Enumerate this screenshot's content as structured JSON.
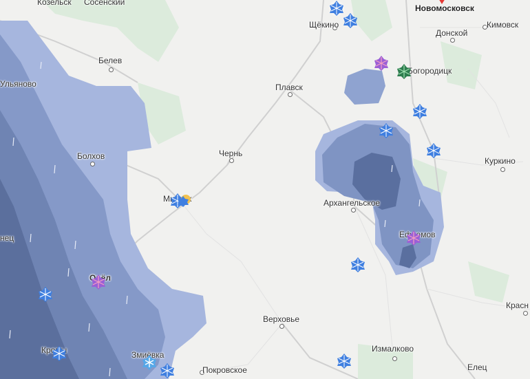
{
  "colors": {
    "land": "#f1f1ef",
    "forest": "#dcebdc",
    "road": "#d6d6d6",
    "precip_light": "#a6b6de",
    "precip_mid": "#7f94c3",
    "precip_heavy": "#5a6f9f",
    "rain_icon": "#3f7fe0",
    "marker_red": "#e53935"
  },
  "cities": [
    {
      "id": "kozelsk",
      "label": "Козельск"
    },
    {
      "id": "sosenskiy",
      "label": "Сосенский"
    },
    {
      "id": "shchekino",
      "label": "Щёкино"
    },
    {
      "id": "novomoskovsk",
      "label": "Новомосковск"
    },
    {
      "id": "donskoy",
      "label": "Донской"
    },
    {
      "id": "kimovsk",
      "label": "Кимовск"
    },
    {
      "id": "belev",
      "label": "Белев"
    },
    {
      "id": "ulyanovo",
      "label": "Ульяново"
    },
    {
      "id": "plavsk",
      "label": "Плавск"
    },
    {
      "id": "bogoroditsk",
      "label": "Богородицк"
    },
    {
      "id": "chern",
      "label": "Чернь"
    },
    {
      "id": "bolkhov",
      "label": "Болхов"
    },
    {
      "id": "kurkino",
      "label": "Куркино"
    },
    {
      "id": "mtsensk",
      "label": "Мценск"
    },
    {
      "id": "arkhangelskoe",
      "label": "Архангельское"
    },
    {
      "id": "efremov",
      "label": "Ефремов"
    },
    {
      "id": "ozhenets",
      "label": "нец"
    },
    {
      "id": "orel",
      "label": "Орёл"
    },
    {
      "id": "verkhovye",
      "label": "Верховье"
    },
    {
      "id": "krasnoe",
      "label": "Красн"
    },
    {
      "id": "kromy",
      "label": "Кромы"
    },
    {
      "id": "zmievka",
      "label": "Змиёвка"
    },
    {
      "id": "izmalkovo",
      "label": "Измалково"
    },
    {
      "id": "pokrovskoe",
      "label": "Покровское"
    },
    {
      "id": "elets",
      "label": "Елец"
    }
  ],
  "weather_markers": [
    {
      "id": "m1",
      "icon": "rain-umbrella-icon"
    },
    {
      "id": "m2",
      "icon": "rain-umbrella-icon"
    },
    {
      "id": "m3",
      "icon": "thunderstorm-umbrella-icon"
    },
    {
      "id": "m4",
      "icon": "hail-umbrella-icon"
    },
    {
      "id": "m5",
      "icon": "rain-umbrella-icon"
    },
    {
      "id": "m6",
      "icon": "rain-umbrella-icon"
    },
    {
      "id": "m7",
      "icon": "rain-umbrella-icon"
    },
    {
      "id": "m8",
      "icon": "rain-umbrella-icon"
    },
    {
      "id": "m9",
      "icon": "thunderstorm-umbrella-icon"
    },
    {
      "id": "m10",
      "icon": "rain-umbrella-icon"
    },
    {
      "id": "m11",
      "icon": "thunderstorm-umbrella-icon"
    },
    {
      "id": "m12",
      "icon": "rain-umbrella-icon"
    },
    {
      "id": "m13",
      "icon": "rain-umbrella-icon"
    },
    {
      "id": "m14",
      "icon": "snow-umbrella-icon"
    },
    {
      "id": "m15",
      "icon": "rain-umbrella-icon"
    },
    {
      "id": "m16",
      "icon": "rain-umbrella-icon"
    },
    {
      "id": "m17",
      "icon": "sun-rain-umbrella-icon"
    }
  ]
}
